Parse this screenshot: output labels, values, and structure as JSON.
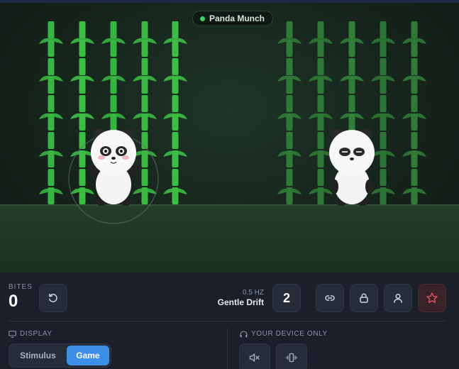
{
  "game": {
    "title": "Panda Munch",
    "colors": {
      "status_dot": "#3fcf6a",
      "bamboo_active": "#3dbd45",
      "bamboo_dim": "#2f7a36",
      "ground": "#243e29"
    }
  },
  "stats": {
    "bites_label": "BITES",
    "bites_value": "0"
  },
  "speed": {
    "hz": "0.5 HZ",
    "name": "Gentle Drift"
  },
  "count": "2",
  "toolbar": {
    "reset_icon": "reset-icon",
    "link_icon": "link-icon",
    "lock_icon": "lock-icon",
    "user_icon": "user-icon",
    "star_icon": "star-icon"
  },
  "display": {
    "label": "DISPLAY",
    "options": [
      "Stimulus",
      "Game"
    ],
    "selected": "Game"
  },
  "device": {
    "label": "YOUR DEVICE ONLY",
    "buttons": [
      "mute-icon",
      "vibrate-icon"
    ]
  },
  "colors": {
    "accent": "#3d8fe8",
    "star": "#e0515f"
  }
}
